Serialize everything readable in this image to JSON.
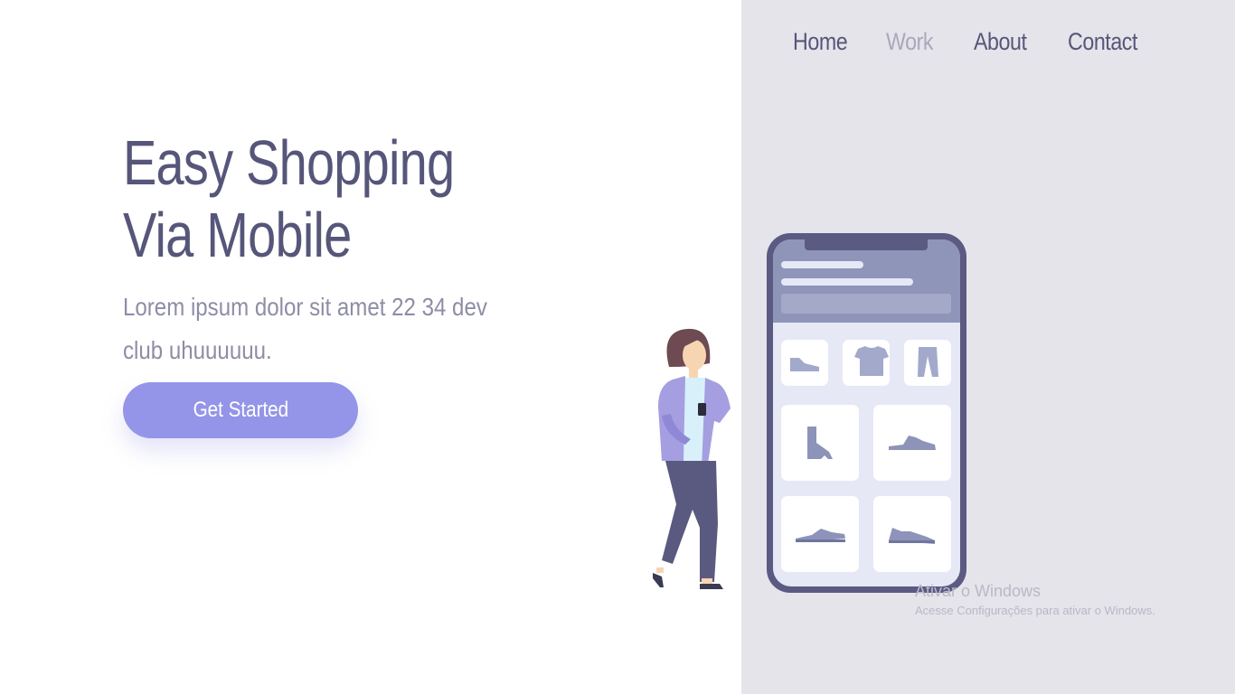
{
  "nav": {
    "items": [
      {
        "label": "Home"
      },
      {
        "label": "Work"
      },
      {
        "label": "About"
      },
      {
        "label": "Contact"
      }
    ]
  },
  "hero": {
    "title_line1": "Easy Shopping",
    "title_line2": "Via Mobile",
    "text": "Lorem ipsum dolor sit amet 22 34 dev club uhuuuuuu.",
    "cta_label": "Get Started"
  },
  "watermark": {
    "title": "Ativar o Windows",
    "subtitle": "Acesse Configurações para ativar o Windows."
  },
  "colors": {
    "accent": "#9495e8",
    "text_dark": "#56567a",
    "text_muted": "#8e8da6",
    "panel_bg": "#e5e4ea",
    "nav_active": "#a9a8bd"
  },
  "icons": [
    "shoe-icon",
    "tshirt-icon",
    "pants-icon",
    "boot-icon",
    "sneaker-icon"
  ]
}
